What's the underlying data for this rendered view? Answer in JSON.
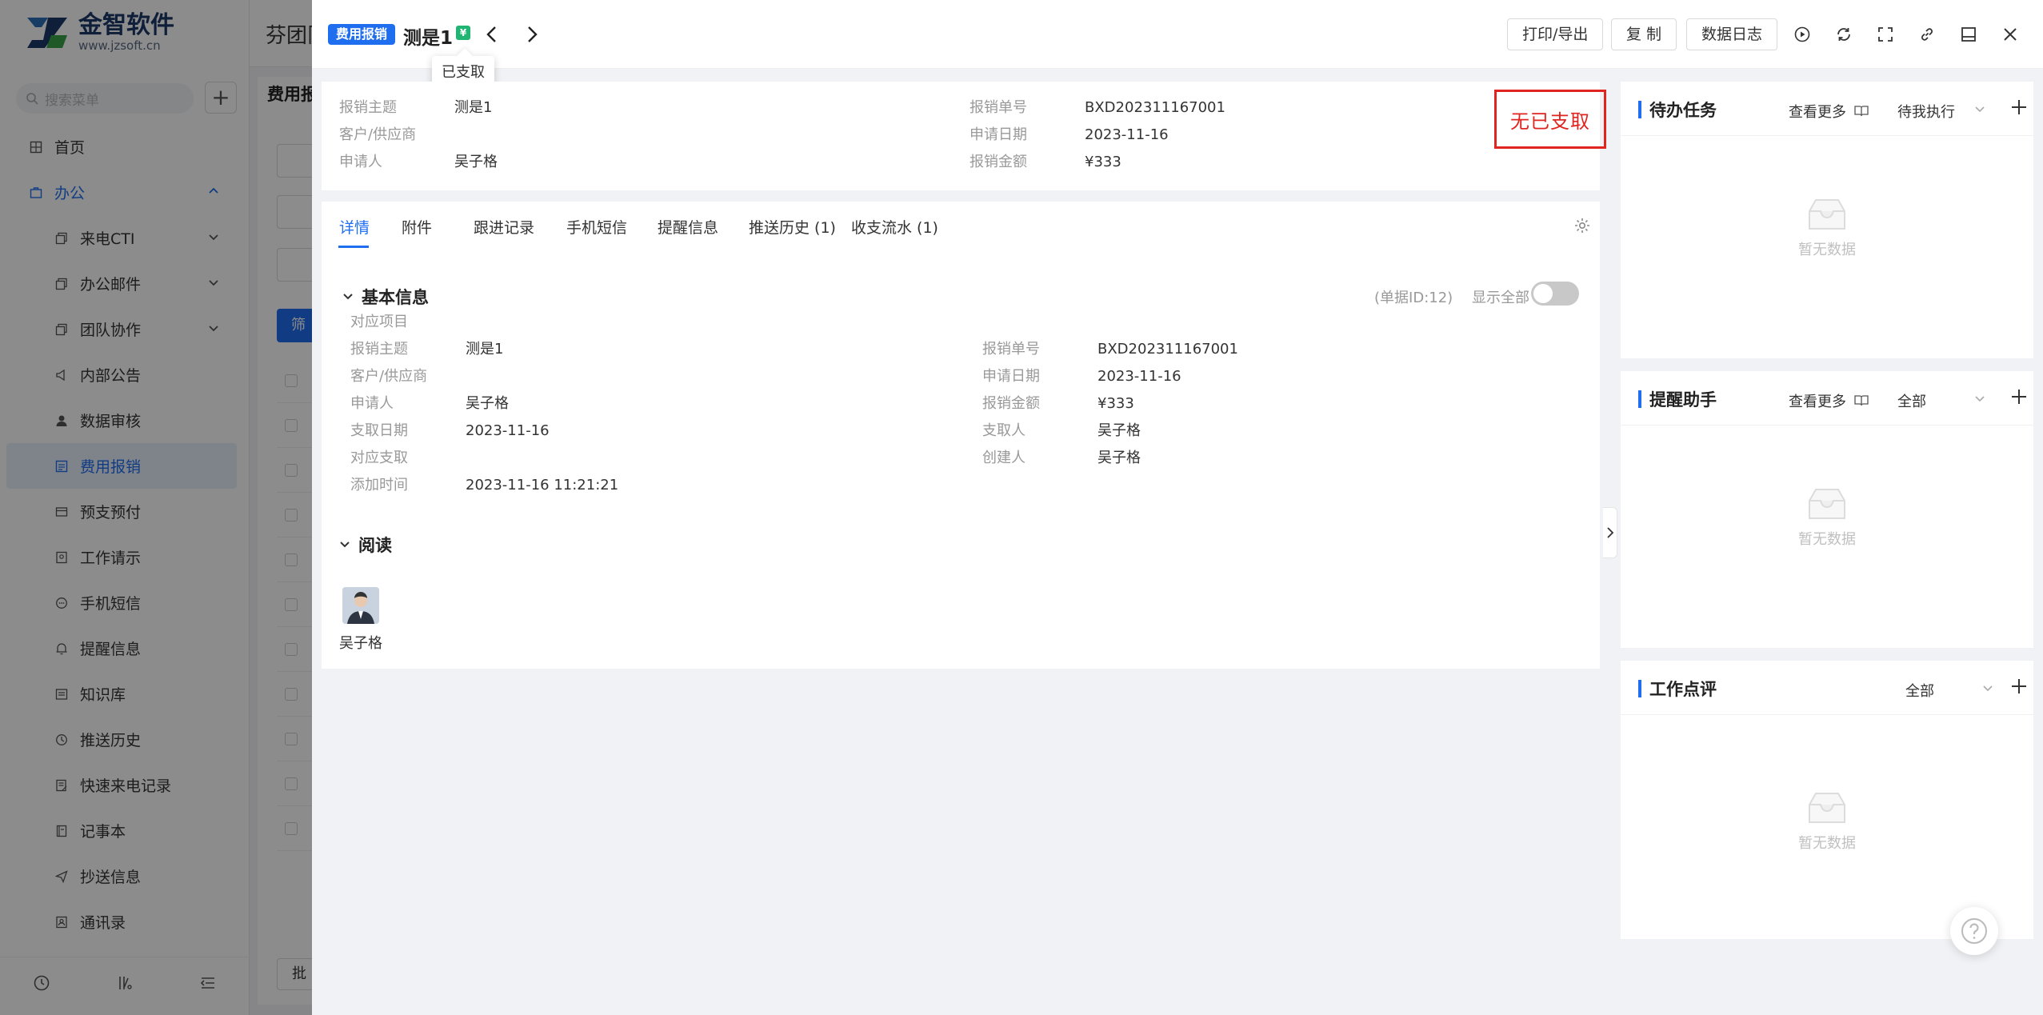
{
  "sidebar": {
    "logo_name": "金智软件",
    "logo_url": "www.jzsoft.cn",
    "search_placeholder": "搜索菜单",
    "items": [
      {
        "label": "首页",
        "icon": "home-icon"
      },
      {
        "label": "办公",
        "icon": "briefcase-icon"
      },
      {
        "label": "来电CTI",
        "icon": "copy-icon"
      },
      {
        "label": "办公邮件",
        "icon": "copy-icon"
      },
      {
        "label": "团队协作",
        "icon": "copy-icon"
      },
      {
        "label": "内部公告",
        "icon": "megaphone-icon"
      },
      {
        "label": "数据审核",
        "icon": "user-icon"
      },
      {
        "label": "费用报销",
        "icon": "receipt-icon"
      },
      {
        "label": "预支预付",
        "icon": "card-icon"
      },
      {
        "label": "工作请示",
        "icon": "doc-icon"
      },
      {
        "label": "手机短信",
        "icon": "chat-icon"
      },
      {
        "label": "提醒信息",
        "icon": "bell-icon"
      },
      {
        "label": "知识库",
        "icon": "book-icon"
      },
      {
        "label": "推送历史",
        "icon": "clock-icon"
      },
      {
        "label": "快速来电记录",
        "icon": "note-icon"
      },
      {
        "label": "记事本",
        "icon": "notebook-icon"
      },
      {
        "label": "抄送信息",
        "icon": "send-icon"
      },
      {
        "label": "通讯录",
        "icon": "contacts-icon"
      }
    ]
  },
  "background": {
    "title": "芬团队",
    "subtitle": "费用报",
    "filter_btn": "筛",
    "batch_btn": "批"
  },
  "drawer": {
    "type_tag": "费用报销",
    "title": "测是1",
    "status_tooltip": "已支取",
    "buttons": {
      "print": "打印/导出",
      "copy": "复 制",
      "log": "数据日志"
    }
  },
  "summary": {
    "left": [
      {
        "k": "报销主题",
        "v": "测是1"
      },
      {
        "k": "客户/供应商",
        "v": ""
      },
      {
        "k": "申请人",
        "v": "吴子格"
      }
    ],
    "right": [
      {
        "k": "报销单号",
        "v": "BXD202311167001"
      },
      {
        "k": "申请日期",
        "v": "2023-11-16"
      },
      {
        "k": "报销金额",
        "v": "¥333"
      }
    ],
    "stamp": "无已支取"
  },
  "tabs": [
    "详情",
    "附件",
    "跟进记录",
    "手机短信",
    "提醒信息",
    "推送历史 (1)",
    "收支流水 (1)"
  ],
  "basic": {
    "title": "基本信息",
    "doc_id": "(单据ID:12)",
    "show_all": "显示全部",
    "related_item_label": "对应项目",
    "left": [
      {
        "k": "报销主题",
        "v": "测是1"
      },
      {
        "k": "客户/供应商",
        "v": ""
      },
      {
        "k": "申请人",
        "v": "吴子格"
      },
      {
        "k": "支取日期",
        "v": "2023-11-16"
      },
      {
        "k": "对应支取",
        "v": ""
      },
      {
        "k": "添加时间",
        "v": "2023-11-16 11:21:21"
      }
    ],
    "right": [
      {
        "k": "报销单号",
        "v": "BXD202311167001"
      },
      {
        "k": "申请日期",
        "v": "2023-11-16"
      },
      {
        "k": "报销金额",
        "v": "¥333"
      },
      {
        "k": "支取人",
        "v": "吴子格"
      },
      {
        "k": "创建人",
        "v": "吴子格"
      }
    ]
  },
  "read": {
    "title": "阅读",
    "user": "吴子格"
  },
  "panels": [
    {
      "title": "待办任务",
      "more": "查看更多",
      "select": "待我执行",
      "empty": "暂无数据"
    },
    {
      "title": "提醒助手",
      "more": "查看更多",
      "select": "全部",
      "empty": "暂无数据"
    },
    {
      "title": "工作点评",
      "more": "",
      "select": "全部",
      "empty": "暂无数据"
    }
  ],
  "colors": {
    "accent": "#1f6ef0",
    "stamp": "#e0241f",
    "status": "#21b573"
  }
}
